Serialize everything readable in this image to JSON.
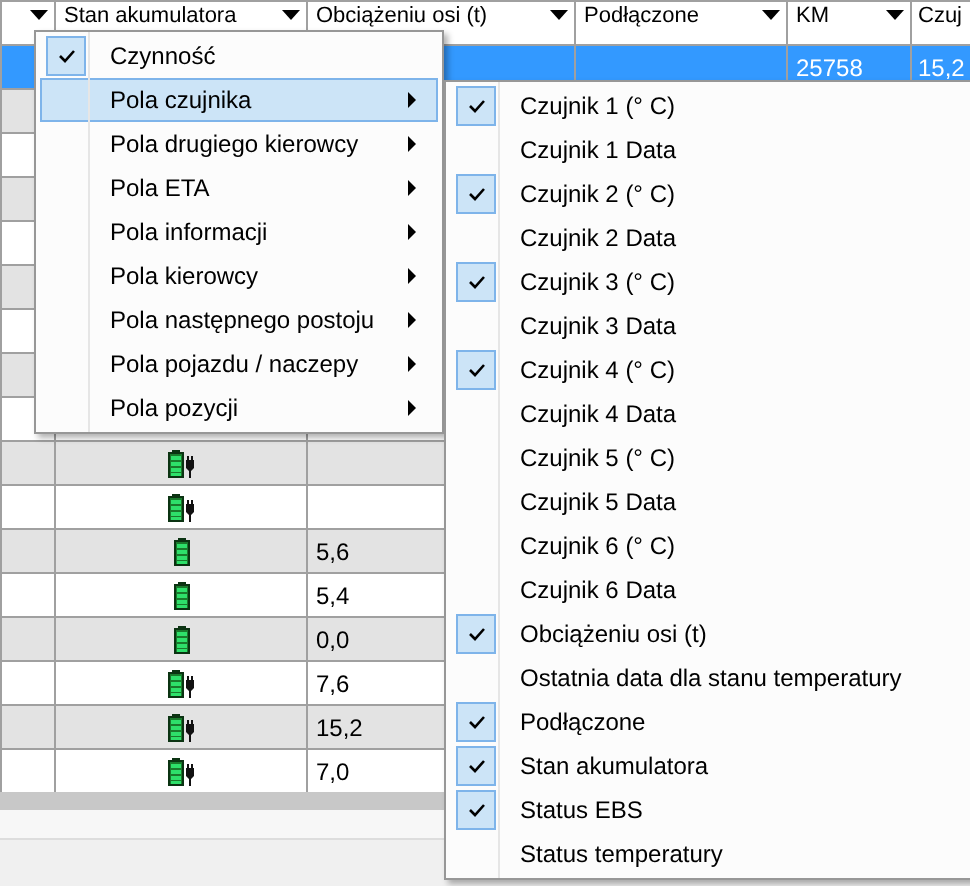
{
  "columns": [
    {
      "dropdown": true
    },
    {
      "label": "Stan akumulatora",
      "dropdown": true
    },
    {
      "label": "Obciążeniu osi (t)",
      "dropdown": true
    },
    {
      "label": "Podłączone",
      "dropdown": true
    },
    {
      "label": "KM",
      "dropdown": true
    },
    {
      "label": "Czuj",
      "dropdown": false
    }
  ],
  "rows": [
    {
      "selected": true,
      "km": "25758",
      "sensor": "15,2"
    },
    {
      "selected": false
    },
    {
      "selected": false
    },
    {
      "selected": false
    },
    {
      "selected": false
    },
    {
      "selected": false
    },
    {
      "selected": false
    },
    {
      "selected": false
    },
    {
      "selected": false
    },
    {
      "selected": false,
      "battery": {
        "kind": "charging"
      }
    },
    {
      "selected": false,
      "battery": {
        "kind": "charging"
      }
    },
    {
      "selected": false,
      "battery": {
        "kind": "full"
      },
      "axle": "5,6"
    },
    {
      "selected": false,
      "battery": {
        "kind": "full"
      },
      "axle": "5,4"
    },
    {
      "selected": false,
      "battery": {
        "kind": "full"
      },
      "axle": "0,0"
    },
    {
      "selected": false,
      "battery": {
        "kind": "charging"
      },
      "axle": "7,6"
    },
    {
      "selected": false,
      "battery": {
        "kind": "charging"
      },
      "axle": "15,2"
    },
    {
      "selected": false,
      "battery": {
        "kind": "charging"
      },
      "axle": "7,0"
    }
  ],
  "menu": {
    "items": [
      {
        "label": "Czynność",
        "checked": true,
        "submenu": false,
        "selected": false
      },
      {
        "label": "Pola czujnika",
        "checked": false,
        "submenu": true,
        "selected": true
      },
      {
        "label": "Pola drugiego kierowcy",
        "checked": false,
        "submenu": true,
        "selected": false
      },
      {
        "label": "Pola ETA",
        "checked": false,
        "submenu": true,
        "selected": false
      },
      {
        "label": "Pola informacji",
        "checked": false,
        "submenu": true,
        "selected": false
      },
      {
        "label": "Pola kierowcy",
        "checked": false,
        "submenu": true,
        "selected": false
      },
      {
        "label": "Pola następnego postoju",
        "checked": false,
        "submenu": true,
        "selected": false
      },
      {
        "label": "Pola pojazdu / naczepy",
        "checked": false,
        "submenu": true,
        "selected": false
      },
      {
        "label": "Pola pozycji",
        "checked": false,
        "submenu": true,
        "selected": false
      }
    ]
  },
  "submenu": {
    "items": [
      {
        "label": "Czujnik 1 (° C)",
        "checked": true
      },
      {
        "label": "Czujnik 1 Data",
        "checked": false
      },
      {
        "label": "Czujnik 2 (° C)",
        "checked": true
      },
      {
        "label": "Czujnik 2 Data",
        "checked": false
      },
      {
        "label": "Czujnik 3 (° C)",
        "checked": true
      },
      {
        "label": "Czujnik 3 Data",
        "checked": false
      },
      {
        "label": "Czujnik 4 (° C)",
        "checked": true
      },
      {
        "label": "Czujnik 4 Data",
        "checked": false
      },
      {
        "label": "Czujnik 5 (° C)",
        "checked": false
      },
      {
        "label": "Czujnik 5 Data",
        "checked": false
      },
      {
        "label": "Czujnik 6 (° C)",
        "checked": false
      },
      {
        "label": "Czujnik 6 Data",
        "checked": false
      },
      {
        "label": "Obciążeniu osi (t)",
        "checked": true
      },
      {
        "label": "Ostatnia data dla stanu temperatury",
        "checked": false
      },
      {
        "label": "Podłączone",
        "checked": true
      },
      {
        "label": "Stan akumulatora",
        "checked": true
      },
      {
        "label": "Status EBS",
        "checked": true
      },
      {
        "label": "Status temperatury",
        "checked": false
      }
    ]
  }
}
